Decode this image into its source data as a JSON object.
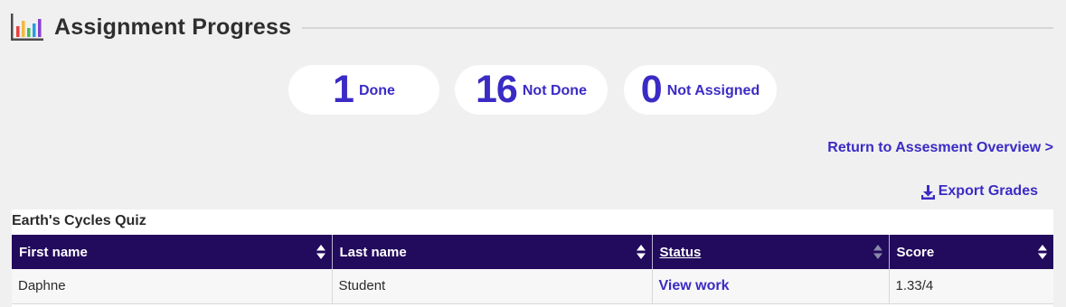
{
  "header": {
    "title": "Assignment Progress",
    "icon": "bar-chart-icon"
  },
  "summary": [
    {
      "count": "1",
      "label": "Done"
    },
    {
      "count": "16",
      "label": "Not Done"
    },
    {
      "count": "0",
      "label": "Not Assigned"
    }
  ],
  "return_link": "Return to Assesment Overview >",
  "export": {
    "label": "Export Grades",
    "icon": "download-icon"
  },
  "table": {
    "title": "Earth's Cycles Quiz",
    "columns": [
      "First name",
      "Last name",
      "Status",
      "Score"
    ],
    "rows": [
      {
        "first_name": "Daphne",
        "last_name": "Student",
        "status": "View work",
        "score": "1.33/4"
      }
    ]
  },
  "colors": {
    "accent": "#3b2bc5",
    "header_bg": "#220a5c",
    "page_bg": "#f0f0f0",
    "chart_bars": [
      "#e8413c",
      "#f5b83d",
      "#3fbf5a",
      "#2c9be0",
      "#8a3fd1"
    ]
  }
}
